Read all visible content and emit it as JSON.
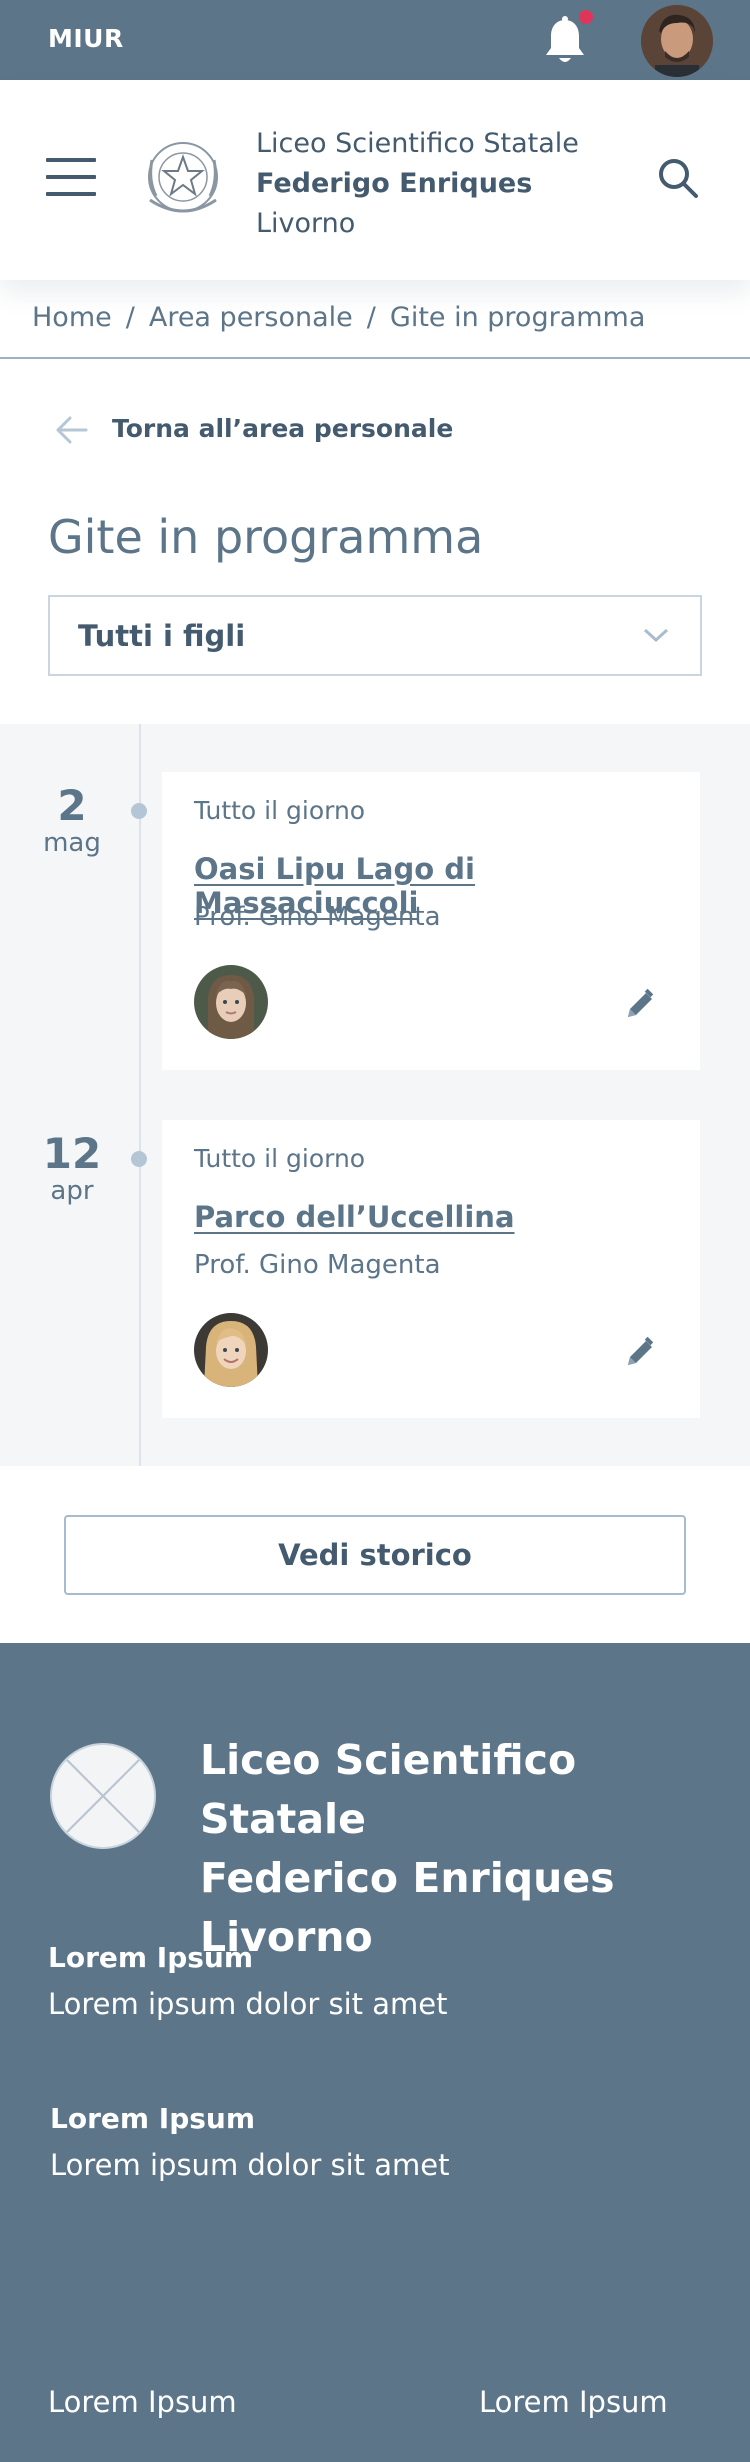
{
  "topbar": {
    "brand": "MIUR",
    "notification_icon": "bell-icon",
    "notification_dot_color": "#e0355b",
    "avatar": "user-avatar"
  },
  "header": {
    "menu_icon": "hamburger-icon",
    "emblem": "italian-republic-emblem",
    "school_line1": "Liceo Scientifico Statale",
    "school_line2": "Federigo Enriques",
    "school_line3": "Livorno",
    "search_icon": "search-icon"
  },
  "breadcrumb": {
    "items": [
      "Home",
      "Area personale",
      "Gite in programma"
    ],
    "separator": "/"
  },
  "back_link": {
    "label": "Torna all’area personale",
    "icon": "arrow-left-icon"
  },
  "page_title": "Gite in programma",
  "filter": {
    "selected": "Tutti i figli",
    "icon": "chevron-down-icon"
  },
  "trips": [
    {
      "day": "2",
      "month": "mag",
      "when": "Tutto il giorno",
      "title": "Oasi Lipu Lago di Massaciuccoli",
      "teacher": "Prof. Gino Magenta",
      "child_avatar": "child-avatar-girl-dark-hair",
      "edit_icon": "pencil-icon"
    },
    {
      "day": "12",
      "month": "apr",
      "when": "Tutto il giorno",
      "title": "Parco dell’Uccellina",
      "teacher": "Prof. Gino Magenta",
      "child_avatar": "child-avatar-girl-blonde",
      "edit_icon": "pencil-icon"
    }
  ],
  "history_button": "Vedi storico",
  "footer": {
    "logo": "placeholder-logo",
    "school_line1": "Liceo Scientifico Statale",
    "school_line2": "Federico Enriques",
    "school_line3": "Livorno",
    "blocks": [
      {
        "heading": "Lorem Ipsum",
        "text": "Lorem ipsum dolor sit amet"
      },
      {
        "heading": "Lorem Ipsum",
        "text": "Lorem ipsum dolor sit amet"
      }
    ],
    "links": [
      "Lorem Ipsum",
      "Lorem Ipsum"
    ]
  },
  "colors": {
    "primary": "#5c7589",
    "text": "#435a6f",
    "timeline_bg": "#f5f6f7",
    "border": "#c9d6e1"
  }
}
